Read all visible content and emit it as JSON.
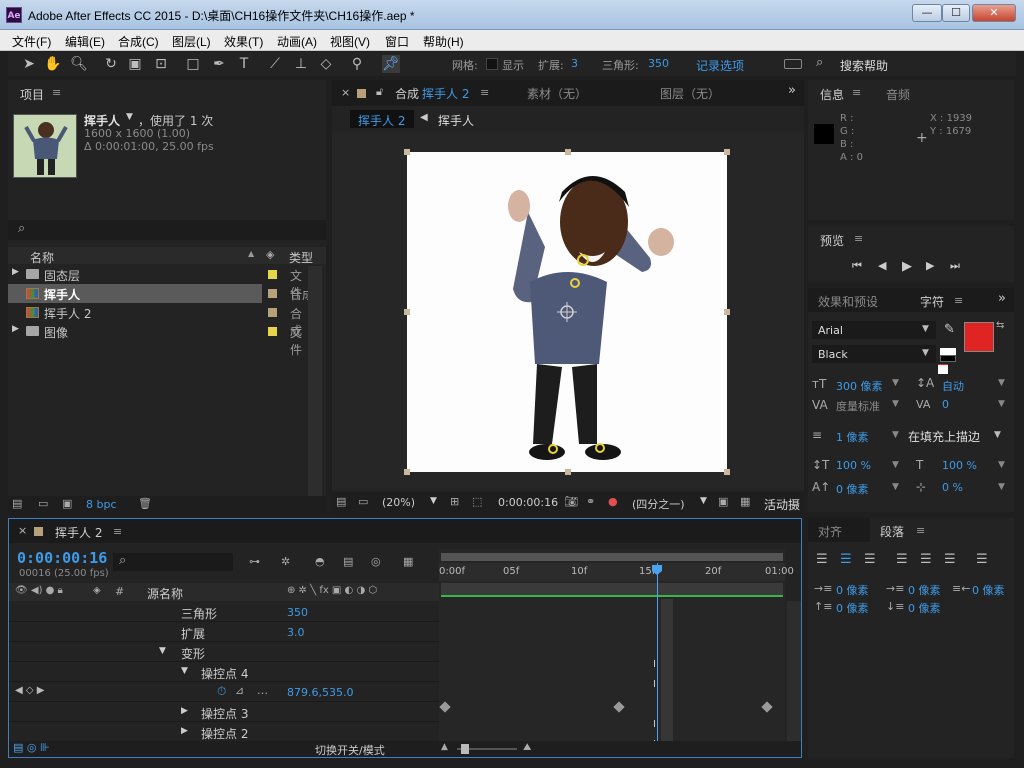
{
  "window": {
    "title": "Adobe After Effects CC 2015 - D:\\桌面\\CH16操作文件夹\\CH16操作.aep *",
    "app_icon": "Ae",
    "minimize": "—",
    "maximize": "☐",
    "close": "✕"
  },
  "menu": [
    "文件(F)",
    "编辑(E)",
    "合成(C)",
    "图层(L)",
    "效果(T)",
    "动画(A)",
    "视图(V)",
    "窗口",
    "帮助(H)"
  ],
  "toolbar": {
    "mesh_label": "网格:",
    "show_label": "显示",
    "expand_label": "扩展:",
    "expand_value": "3",
    "triangles_label": "三角形:",
    "triangles_value": "350",
    "record_options": "记录选项",
    "search_help": "搜索帮助"
  },
  "project": {
    "tab": "项目",
    "item_name": "挥手人",
    "used": "，使用了 1 次",
    "dims": "1600 x 1600 (1.00)",
    "duration": "Δ 0:00:01:00, 25.00 fps",
    "col_name": "名称",
    "col_type": "类型",
    "rows": [
      {
        "name": "固态层",
        "type": "文件",
        "kind": "folder",
        "color": "#e6d44a"
      },
      {
        "name": "挥手人",
        "type": "合成",
        "kind": "comp",
        "color": "#b8a07a"
      },
      {
        "name": "挥手人 2",
        "type": "合成",
        "kind": "comp",
        "color": "#b8a07a"
      },
      {
        "name": "图像",
        "type": "文件",
        "kind": "folder",
        "color": "#e6d44a"
      }
    ],
    "bpc": "8 bpc"
  },
  "comp": {
    "close": "×",
    "tab_prefix": "合成",
    "tab_name": "挥手人 2",
    "tab_footage": "素材（无）",
    "tab_layer": "图层（无）",
    "crumb_active": "挥手人 2",
    "crumb_parent": "挥手人",
    "zoom": "(20%)",
    "timecode": "0:00:00:16",
    "resolution": "(四分之一)",
    "active_camera": "活动摄"
  },
  "info": {
    "tab": "信息",
    "tab_audio": "音频",
    "r": "R :",
    "g": "G :",
    "b": "B :",
    "a": "A : 0",
    "x": "X : 1939",
    "y": "Y : 1679"
  },
  "preview": {
    "tab": "预览"
  },
  "character": {
    "tab_effects": "效果和预设",
    "tab_char": "字符",
    "font": "Arial",
    "style": "Black",
    "size": "300 像素",
    "leading": "自动",
    "kerning": "度量标准",
    "tracking": "0",
    "stroke_width": "1 像素",
    "stroke_mode": "在填充上描边",
    "vscale": "100 %",
    "hscale": "100 %",
    "baseline": "0 像素",
    "tsume": "0 %",
    "fill_color": "#e02424"
  },
  "paragraph": {
    "tab_align": "对齐",
    "tab_para": "段落",
    "indent1": "0 像素",
    "indent2": "0 像素",
    "indent3": "0 像素",
    "space1": "0 像素",
    "space2": "0 像素"
  },
  "timeline": {
    "close": "×",
    "tab": "挥手人 2",
    "timecode": "0:00:00:16",
    "fps": "00016 (25.00 fps)",
    "col_hash": "#",
    "col_source": "源名称",
    "ruler": [
      "0:00f",
      "05f",
      "10f",
      "15f",
      "20f",
      "01:00"
    ],
    "layers": [
      {
        "label": "三角形",
        "value": "350",
        "indent": 0,
        "arrow": ""
      },
      {
        "label": "扩展",
        "value": "3.0",
        "indent": 0,
        "arrow": ""
      },
      {
        "label": "变形",
        "value": "",
        "indent": 0,
        "arrow": "▼"
      },
      {
        "label": "操控点 4",
        "value": "",
        "indent": 1,
        "arrow": "▼"
      },
      {
        "label": "",
        "value": "879.6,535.0",
        "indent": 2,
        "arrow": ""
      },
      {
        "label": "操控点 3",
        "value": "",
        "indent": 1,
        "arrow": "▶"
      },
      {
        "label": "操控点 2",
        "value": "",
        "indent": 1,
        "arrow": "▶"
      }
    ],
    "toggle_label": "切换开关/模式"
  }
}
